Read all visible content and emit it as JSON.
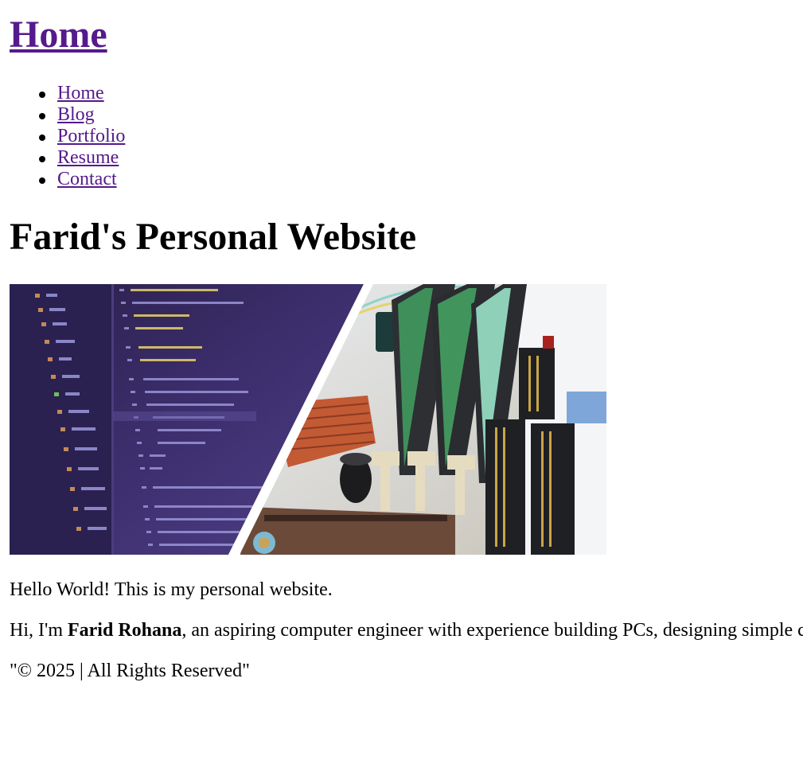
{
  "header": {
    "title_link": "Home"
  },
  "nav": {
    "items": [
      {
        "label": "Home"
      },
      {
        "label": "Blog"
      },
      {
        "label": "Portfolio"
      },
      {
        "label": "Resume"
      },
      {
        "label": "Contact"
      }
    ]
  },
  "main": {
    "heading": "Farid's Personal Website",
    "hero_image_icon": "code-and-motherboard-image",
    "greeting": "Hello World! This is my personal website.",
    "intro_prefix": "Hi, I'm ",
    "intro_name": "Farid Rohana",
    "intro_suffix": ", an aspiring computer engineer with experience building PCs, designing simple c"
  },
  "footer": {
    "copyright": "\"© 2025 | All Rights Reserved\""
  },
  "colors": {
    "link_visited": "#551a8b",
    "text": "#000000",
    "background": "#ffffff"
  }
}
